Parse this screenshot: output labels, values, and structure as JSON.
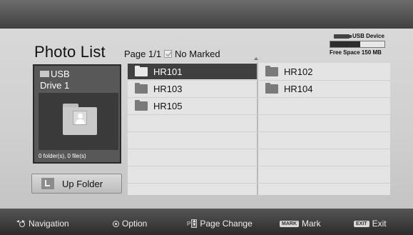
{
  "header": {
    "title": "Photo List",
    "page_info": "Page 1/1",
    "marked_text": "No Marked"
  },
  "device": {
    "label": "USB Device",
    "free_space": "Free Space 150 MB",
    "used_fraction": 0.55
  },
  "drive": {
    "name_line1": "USB",
    "name_line2": "Drive 1",
    "count": "0 folder(s), 0 file(s)"
  },
  "up_folder": {
    "label": "Up Folder"
  },
  "folders": [
    {
      "name": "HR101",
      "selected": true
    },
    {
      "name": "HR102",
      "selected": false
    },
    {
      "name": "HR103",
      "selected": false
    },
    {
      "name": "HR104",
      "selected": false
    },
    {
      "name": "HR105",
      "selected": false
    }
  ],
  "footer": {
    "navigation": "Navigation",
    "option": "Option",
    "page_key": "P",
    "page_change": "Page Change",
    "mark_key": "MARK",
    "mark": "Mark",
    "exit_key": "EXIT",
    "exit": "Exit"
  },
  "colors": {
    "selected_bg": "#404040",
    "panel_bg": "#d4d4d4",
    "list_bg": "#e4e4e4"
  }
}
